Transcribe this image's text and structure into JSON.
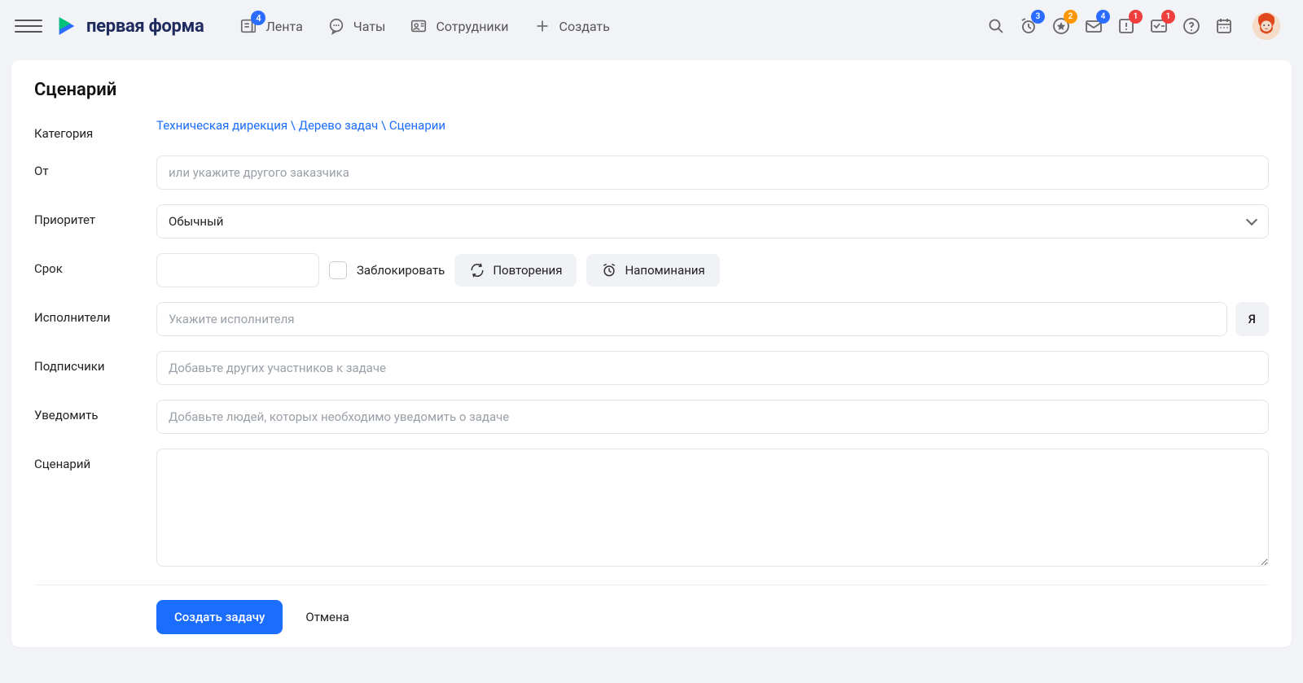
{
  "header": {
    "logo_text": "первая форма",
    "nav": {
      "feed": {
        "label": "Лента",
        "badge": "4"
      },
      "chats": {
        "label": "Чаты"
      },
      "employees": {
        "label": "Сотрудники"
      },
      "create": {
        "label": "Создать"
      }
    },
    "icons": {
      "clock_badge": "3",
      "favorites_badge": "2",
      "mail_badge": "4",
      "alert_badge": "1",
      "tasks_badge": "1"
    }
  },
  "page": {
    "title": "Сценарий",
    "labels": {
      "category": "Категория",
      "from": "От",
      "priority": "Приоритет",
      "deadline": "Срок",
      "executors": "Исполнители",
      "subscribers": "Подписчики",
      "notify": "Уведомить",
      "scenario": "Сценарий"
    },
    "breadcrumb": "Техническая дирекция \\ Дерево задач \\ Сценарии",
    "placeholders": {
      "from": "или укажите другого заказчика",
      "executors": "Укажите исполнителя",
      "subscribers": "Добавьте других участников к задаче",
      "notify": "Добавьте людей, которых необходимо уведомить о задаче"
    },
    "priority_value": "Обычный",
    "deadline": {
      "block_label": "Заблокировать",
      "repeat_label": "Повторения",
      "reminder_label": "Напоминания"
    },
    "me_button": "Я",
    "footer": {
      "submit": "Создать задачу",
      "cancel": "Отмена"
    }
  }
}
